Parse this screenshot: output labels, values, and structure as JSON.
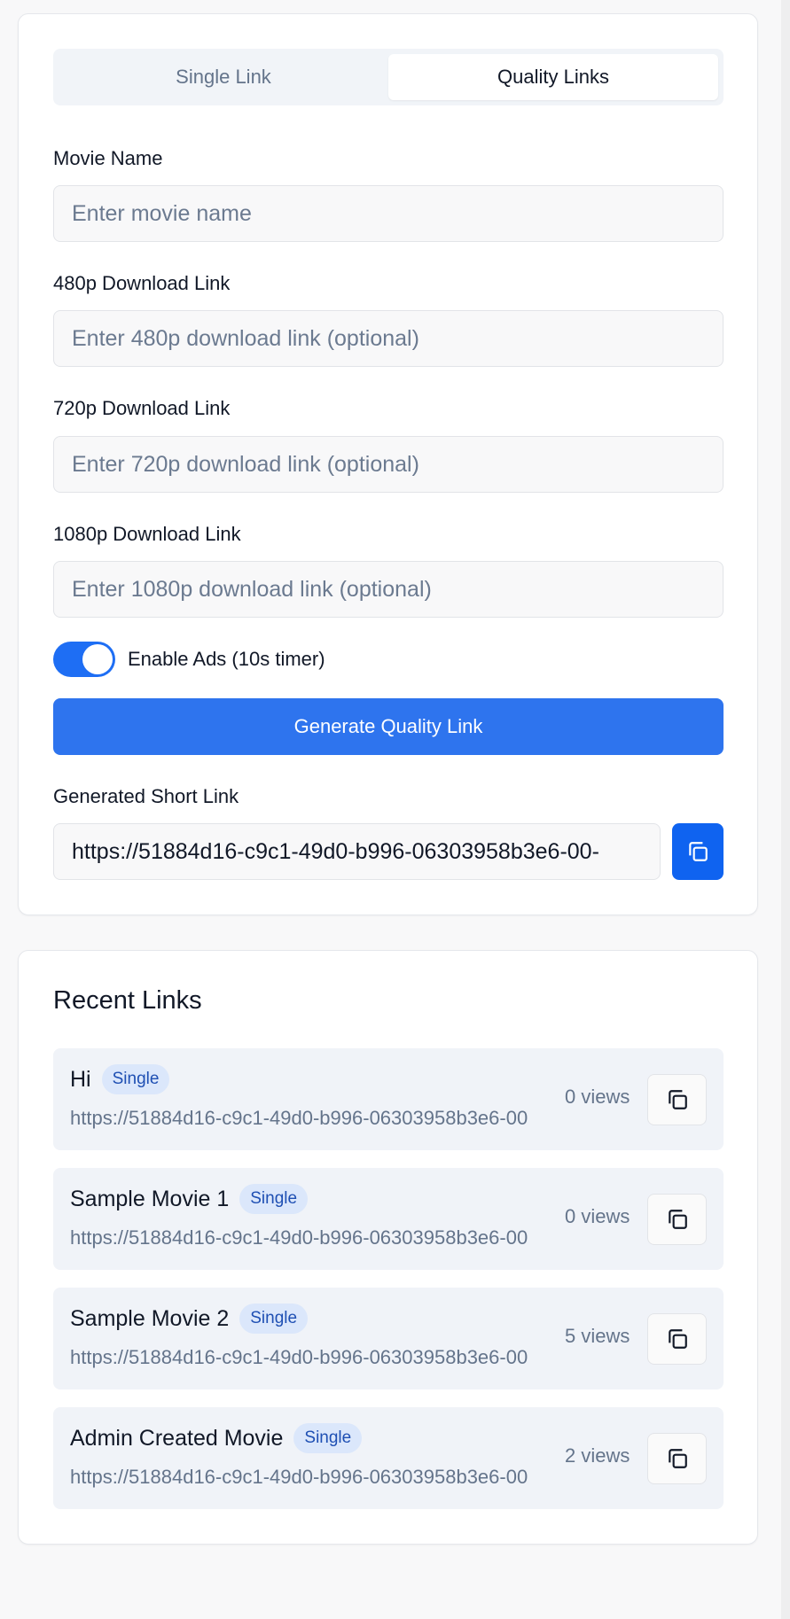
{
  "tabs": [
    {
      "label": "Single Link",
      "active": false
    },
    {
      "label": "Quality Links",
      "active": true
    }
  ],
  "form": {
    "movie_name": {
      "label": "Movie Name",
      "placeholder": "Enter movie name",
      "value": ""
    },
    "link_480": {
      "label": "480p Download Link",
      "placeholder": "Enter 480p download link (optional)",
      "value": ""
    },
    "link_720": {
      "label": "720p Download Link",
      "placeholder": "Enter 720p download link (optional)",
      "value": ""
    },
    "link_1080": {
      "label": "1080p Download Link",
      "placeholder": "Enter 1080p download link (optional)",
      "value": ""
    },
    "ads_toggle": {
      "label": "Enable Ads (10s timer)",
      "enabled": true
    },
    "generate_label": "Generate Quality Link",
    "generated": {
      "label": "Generated Short Link",
      "value": "https://51884d16-c9c1-49d0-b996-06303958b3e6-00-"
    }
  },
  "recent": {
    "title": "Recent Links",
    "items": [
      {
        "name": "Hi",
        "badge": "Single",
        "url": "https://51884d16-c9c1-49d0-b996-06303958b3e6-00",
        "views": "0 views"
      },
      {
        "name": "Sample Movie 1",
        "badge": "Single",
        "url": "https://51884d16-c9c1-49d0-b996-06303958b3e6-00",
        "views": "0 views"
      },
      {
        "name": "Sample Movie 2",
        "badge": "Single",
        "url": "https://51884d16-c9c1-49d0-b996-06303958b3e6-00",
        "views": "5 views"
      },
      {
        "name": "Admin Created Movie",
        "badge": "Single",
        "url": "https://51884d16-c9c1-49d0-b996-06303958b3e6-00",
        "views": "2 views"
      }
    ]
  },
  "icons": {
    "copy": "copy-icon"
  },
  "colors": {
    "accent": "#2e74ee",
    "copy_button": "#0f63f0",
    "badge_bg": "#dbe7fb",
    "badge_text": "#1e4fb3"
  }
}
